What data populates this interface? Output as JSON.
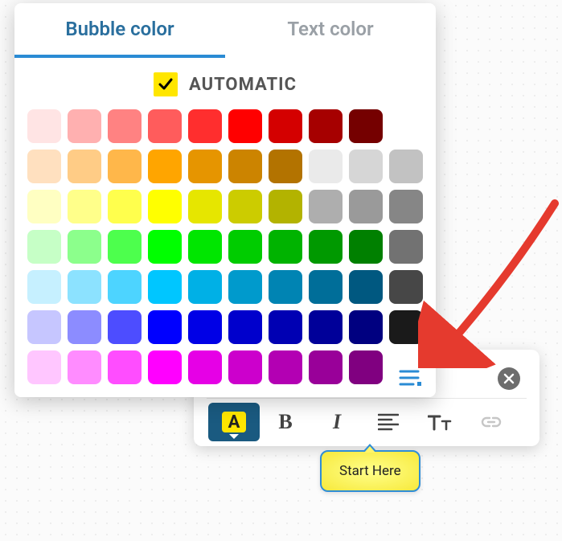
{
  "picker": {
    "tabs": {
      "bubble": "Bubble color",
      "text": "Text color",
      "active": "bubble"
    },
    "automatic_label": "AUTOMATIC",
    "automatic_checked": true,
    "swatches": [
      [
        "#ffe4e4",
        "#ffb0b0",
        "#ff8282",
        "#ff5c5c",
        "#ff2e2e",
        "#ff0000",
        "#d40000",
        "#a60000",
        "#750000",
        ""
      ],
      [
        "#ffe0bf",
        "#ffcc86",
        "#ffb74a",
        "#ffa500",
        "#e69500",
        "#cc8400",
        "#b37300",
        "#eaeaea",
        "#d6d6d6",
        "#c2c2c2"
      ],
      [
        "#ffffc2",
        "#ffff8a",
        "#ffff4d",
        "#ffff00",
        "#e6e600",
        "#cccc00",
        "#b3b300",
        "#aeaeae",
        "#9a9a9a",
        "#868686"
      ],
      [
        "#c6ffc6",
        "#8cff8c",
        "#4dff4d",
        "#00ff00",
        "#00e600",
        "#00cc00",
        "#00b300",
        "#009900",
        "#008000",
        "#727272"
      ],
      [
        "#c6f0ff",
        "#8ce2ff",
        "#4dd4ff",
        "#00c6ff",
        "#00b0e6",
        "#009acc",
        "#0084b3",
        "#006e99",
        "#005880",
        "#474747"
      ],
      [
        "#c6c6ff",
        "#8c8cff",
        "#4d4dff",
        "#0000ff",
        "#0000e6",
        "#0000cc",
        "#0000b3",
        "#000099",
        "#000080",
        "#1a1a1a"
      ],
      [
        "#ffc6ff",
        "#ff8cff",
        "#ff4dff",
        "#ff00ff",
        "#e600e6",
        "#cc00cc",
        "#b300b3",
        "#990099",
        "#800080",
        ""
      ]
    ]
  },
  "toolbar": {
    "letter": "A",
    "close": "close"
  },
  "bubble": {
    "text": "Start Here"
  }
}
